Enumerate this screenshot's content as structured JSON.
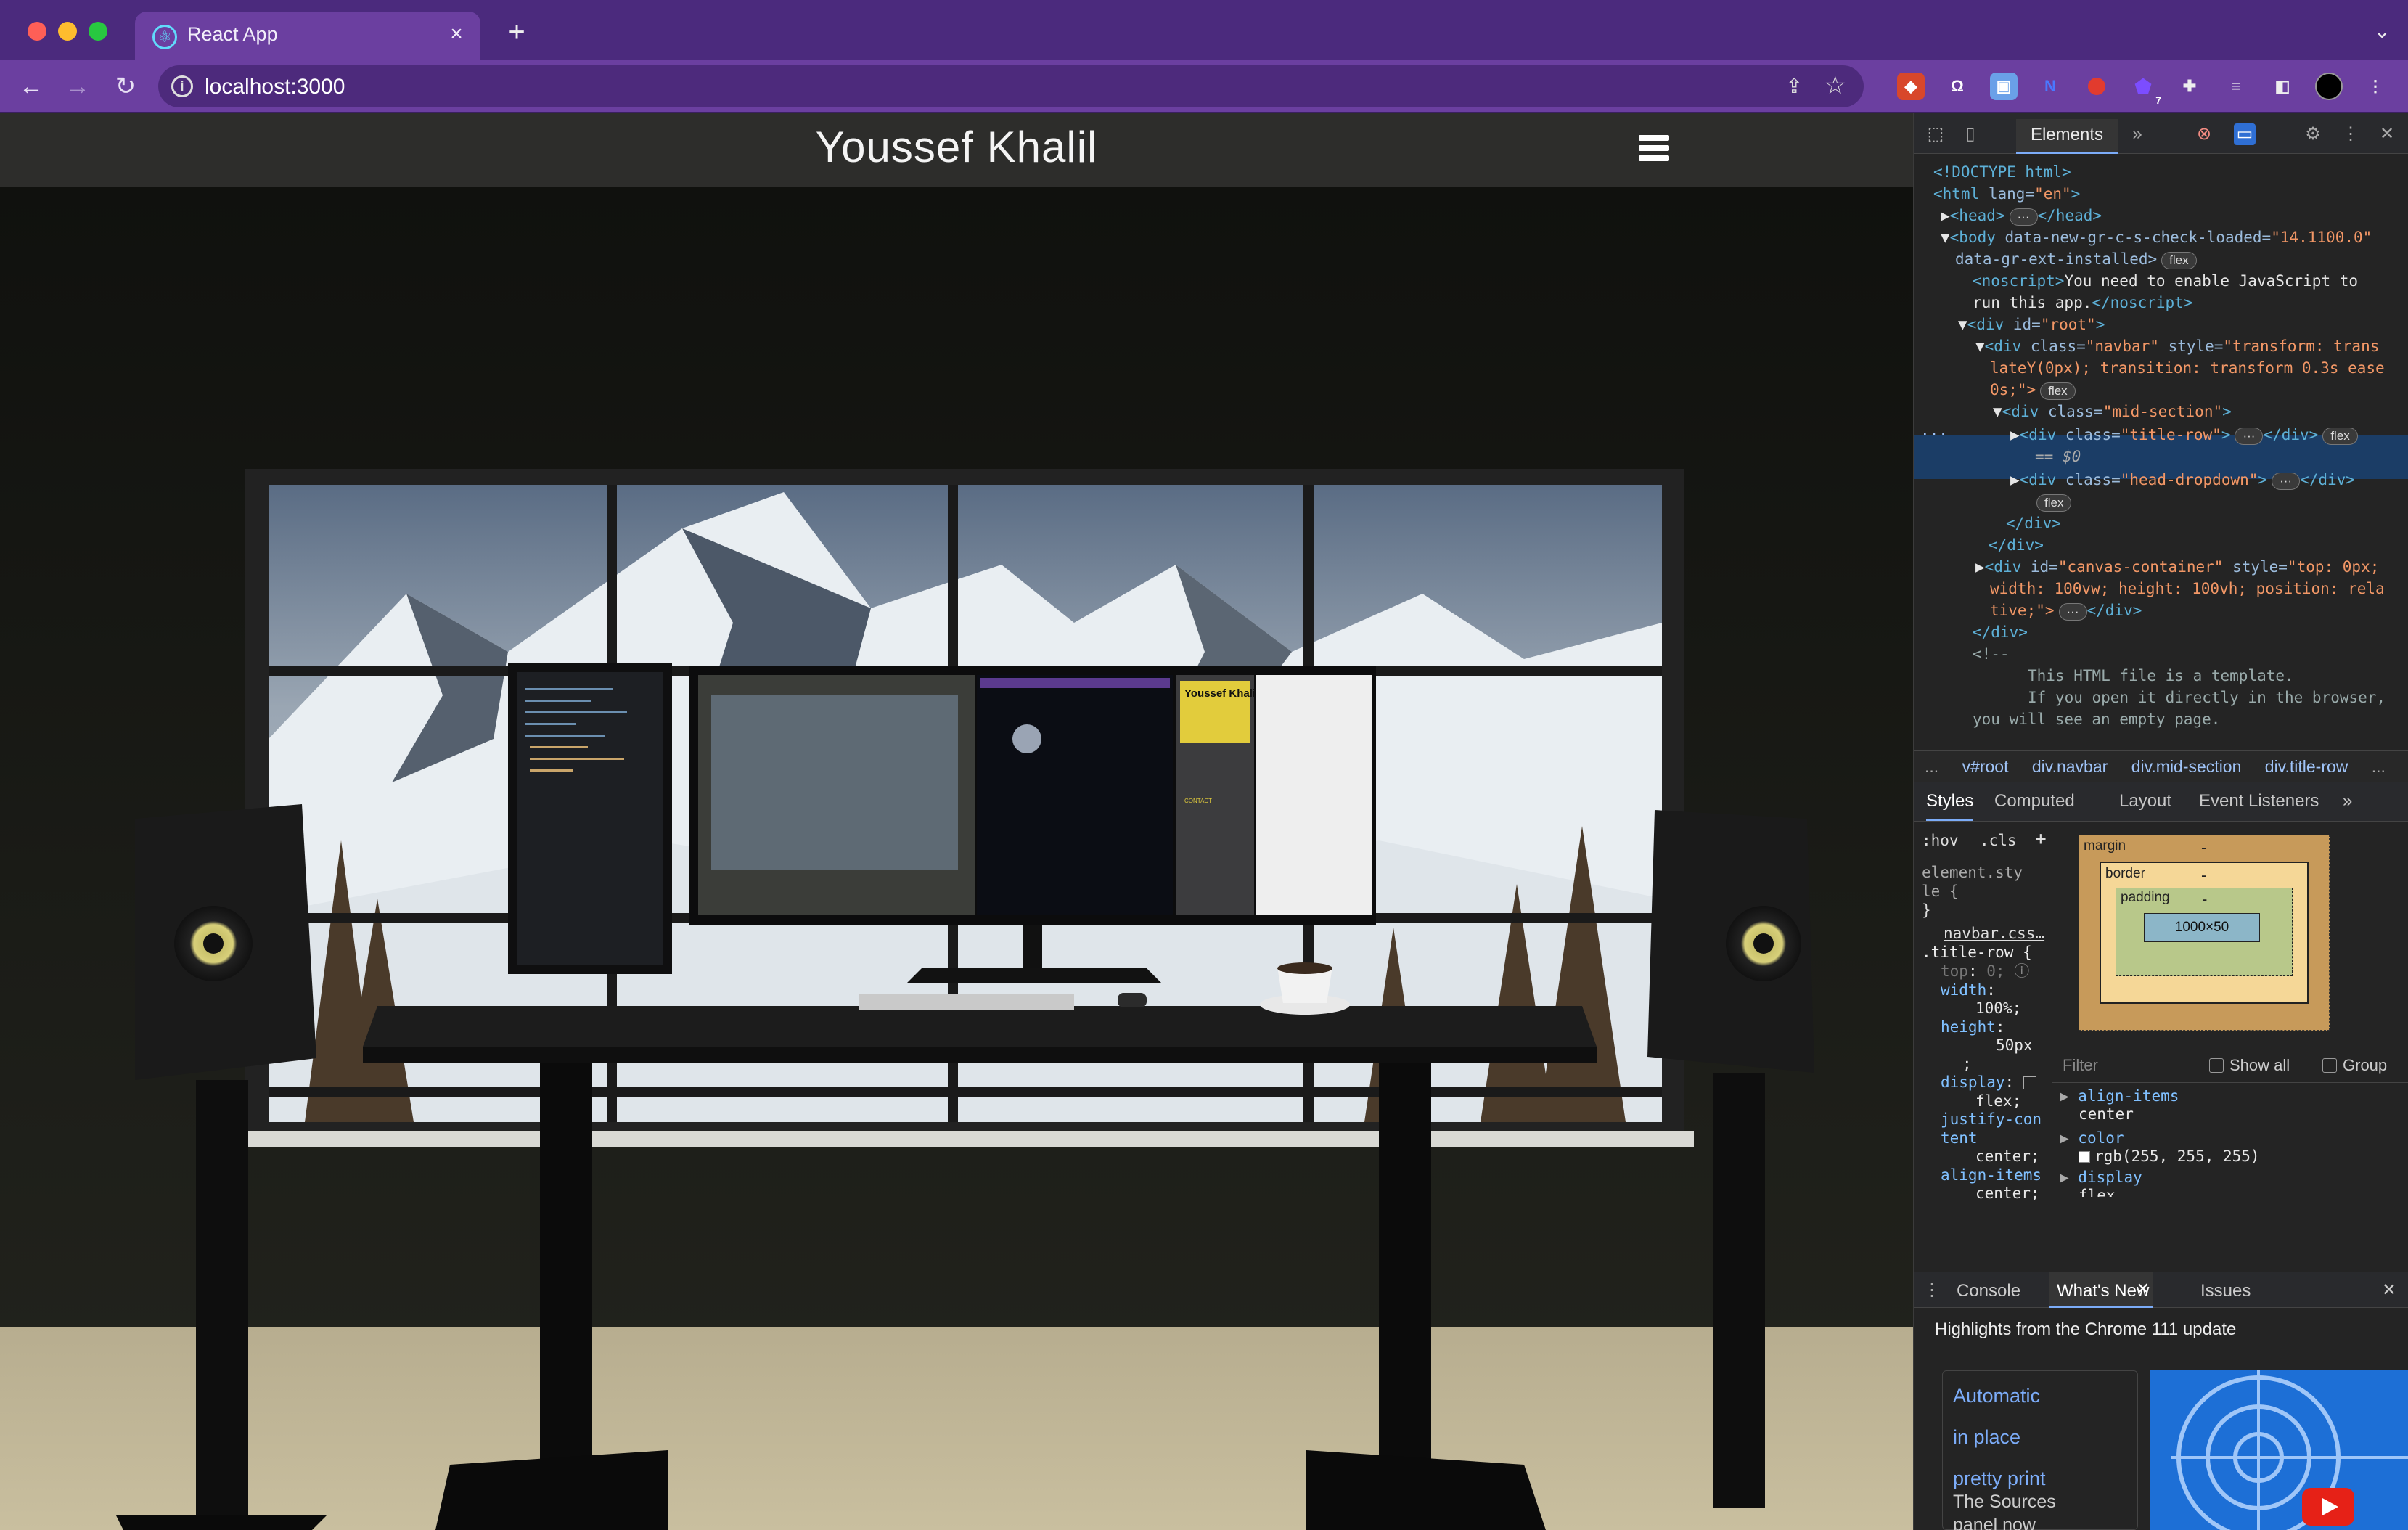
{
  "browser": {
    "tab_title": "React App",
    "tab_close": "×",
    "new_tab": "+",
    "tab_menu": "⌄",
    "url": "localhost:3000",
    "extension_badge": "7"
  },
  "site": {
    "title": "Youssef Khalil",
    "monitor_resume_name": "Youssef Khalil",
    "monitor_contact_label": "CONTACT"
  },
  "devtools": {
    "tabs": {
      "elements": "Elements",
      "more": "»"
    },
    "dom": {
      "doctype": "<!DOCTYPE html>",
      "html_open_tag": "<html",
      "html_lang_attr": "lang=",
      "html_lang_val": "\"en\"",
      "head_tag": "<head>",
      "head_close": "</head>",
      "body_tag": "<body",
      "body_attr1": "data-new-gr-c-s-check-loaded=",
      "body_val1": "\"14.1100.0\"",
      "body_attr2": "data-gr-ext-installed>",
      "noscript_open": "<noscript>",
      "noscript_text1": "You need to enable JavaScript to",
      "noscript_text2": "run this app.",
      "noscript_close": "</noscript>",
      "root_tag": "<div",
      "root_attr": "id=",
      "root_val": "\"root\"",
      "navbar_attr": "class=",
      "navbar_val": "\"navbar\"",
      "navbar_style_attr": "style=",
      "navbar_style_val1": "\"transform: trans",
      "navbar_style_val2": "lateY(0px); transition: transform 0.3s ease",
      "navbar_style_val3": "0s;\">",
      "mid_val": "\"mid-section\"",
      "title_row_val": "\"title-row\"",
      "selected_marker": "== $0",
      "head_dropdown_val": "\"head-dropdown\"",
      "div_close": "</div>",
      "canvas_val": "\"canvas-container\"",
      "canvas_style_val1": "\"top: 0px;",
      "canvas_style_val2": "width: 100vw; height: 100vh; position: rela",
      "canvas_style_val3": "tive;\">",
      "comment_open": "<!--",
      "comment_line1": "This HTML file is a template.",
      "comment_line2": "If you open it directly in the browser,",
      "comment_line3": "you will see an empty page.",
      "flex_badge": "flex",
      "ellipsis": "···"
    },
    "breadcrumbs": [
      "...",
      "v#root",
      "div.navbar",
      "div.mid-section",
      "div.title-row",
      "..."
    ],
    "styles_tabs": [
      "Styles",
      "Computed",
      "Layout",
      "Event Listeners",
      "»"
    ],
    "styles": {
      "hov": ":hov",
      "cls": ".cls",
      "plus": "+",
      "element_style1": "element.sty",
      "element_style2": "le {",
      "brace_close": "}",
      "source": "navbar.css…",
      "selector": ".title-row {",
      "props": [
        {
          "name": "top",
          "value": "0;"
        },
        {
          "name": "width",
          "value": "100%;"
        },
        {
          "name": "height",
          "value": "50px"
        },
        {
          "name": "display",
          "value": "flex;"
        },
        {
          "name": "justify-content",
          "value": "center;"
        },
        {
          "name": "align-items",
          "value": "center;"
        }
      ]
    },
    "box_model": {
      "margin": "margin",
      "border": "border",
      "padding": "padding",
      "content": "1000×50",
      "dash": "-"
    },
    "computed": {
      "filter_placeholder": "Filter",
      "show_all": "Show all",
      "group": "Group",
      "items": [
        {
          "name": "align-items",
          "value": "center"
        },
        {
          "name": "color",
          "value": "rgb(255, 255, 255)"
        },
        {
          "name": "display",
          "value": "flex"
        }
      ]
    },
    "drawer": {
      "tabs": [
        "Console",
        "What's New",
        "Issues"
      ],
      "headline": "Highlights from the Chrome 111 update",
      "card_line1": "Automatic",
      "card_line2": "in place",
      "card_line3": "pretty print",
      "card_line4": "The Sources",
      "card_line5": "panel now"
    }
  },
  "colors": {
    "chrome_tabstrip": "#4b2a7d",
    "chrome_toolbar": "#6b3fa0",
    "page_bg": "#151612",
    "devtools_bg": "#242424",
    "selection": "#1b3d66"
  }
}
